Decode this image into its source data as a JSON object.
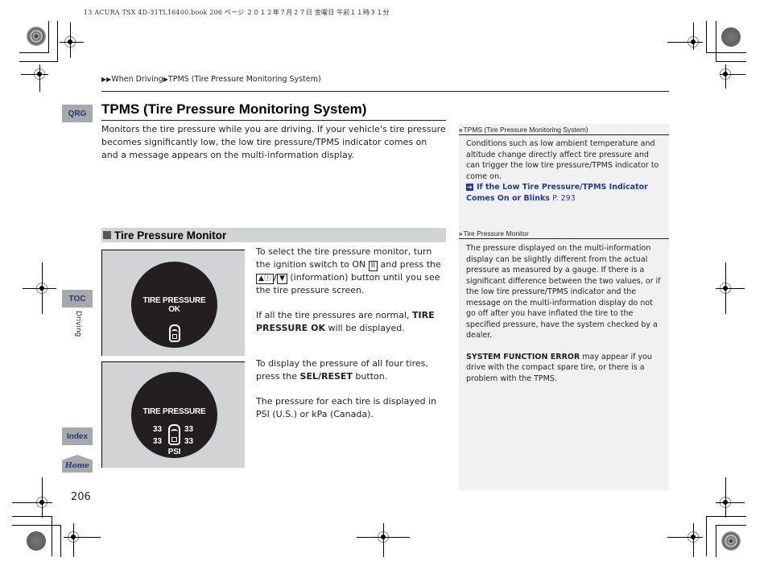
{
  "print_header": "13 ACURA TSX 4D-31TL16400.book  206 ページ  ２０１２年７月２７日  金曜日  午前１１時３１分",
  "breadcrumb": {
    "arrows": "▶▶",
    "items": [
      "When Driving",
      "TPMS (Tire Pressure Monitoring System)"
    ],
    "separator": "▶"
  },
  "nav_tabs": {
    "qrg": "QRG",
    "toc": "TOC",
    "section_label": "Driving",
    "index": "Index",
    "home": "Home"
  },
  "page_number": "206",
  "main": {
    "title": "TPMS (Tire Pressure Monitoring System)",
    "intro": "Monitors the tire pressure while you are driving. If your vehicle's tire pressure becomes significantly low, the low tire pressure/TPMS indicator comes on and a message appears on the multi-information display.",
    "section": {
      "heading": "Tire Pressure Monitor",
      "screen1": {
        "line1": "TIRE PRESSURE",
        "line2": "OK"
      },
      "screen2": {
        "line1": "TIRE PRESSURE",
        "values": [
          "33",
          "33",
          "33",
          "33"
        ],
        "unit": "PSI"
      },
      "para1_a": "To select the tire pressure monitor, turn the ignition switch to ON ",
      "para1_key_on": "II",
      "para1_b": " and press the ",
      "para1_key_info": "▲ⓘ",
      "para1_slash": "/",
      "para1_key_down": "▼",
      "para1_c": " (information) button until you see the tire pressure screen.",
      "para2_a": "If all the tire pressures are normal, ",
      "para2_bold": "TIRE PRESSURE OK",
      "para2_b": " will be displayed.",
      "para3_a": "To display the pressure of all four tires, press the ",
      "para3_bold": "SEL/RESET",
      "para3_b": " button.",
      "para4": "The pressure for each tire is displayed in PSI (U.S.) or kPa (Canada)."
    }
  },
  "sidebar": {
    "note1": {
      "heading": "TPMS (Tire Pressure Monitoring System)",
      "text": "Conditions such as low ambient temperature and altitude change directly affect tire pressure and can trigger the low tire pressure/TPMS indicator to come on.",
      "link_text": "If the Low Tire Pressure/TPMS Indicator Comes On or Blinks",
      "link_page": "P. 293"
    },
    "note2": {
      "heading": "Tire Pressure Monitor",
      "text": "The pressure displayed on the multi-information display can be slightly different from the actual pressure as measured by a gauge. If there is a significant difference between the two values, or if the low tire pressure/TPMS indicator and the message on the multi-information display do not go off after you have inflated the tire to the specified pressure, have the system checked by a dealer.",
      "error_bold": "SYSTEM FUNCTION ERROR",
      "error_text": " may appear if you drive with the compact spare tire, or there is a problem with the TPMS."
    }
  },
  "colors": {
    "nav_tab_bg": "#a7a9ac",
    "nav_tab_text": "#1f3c72",
    "link": "#1f3c99",
    "sidebar_bg": "#f1f1f2",
    "section_bar": "#d1d3d4"
  }
}
